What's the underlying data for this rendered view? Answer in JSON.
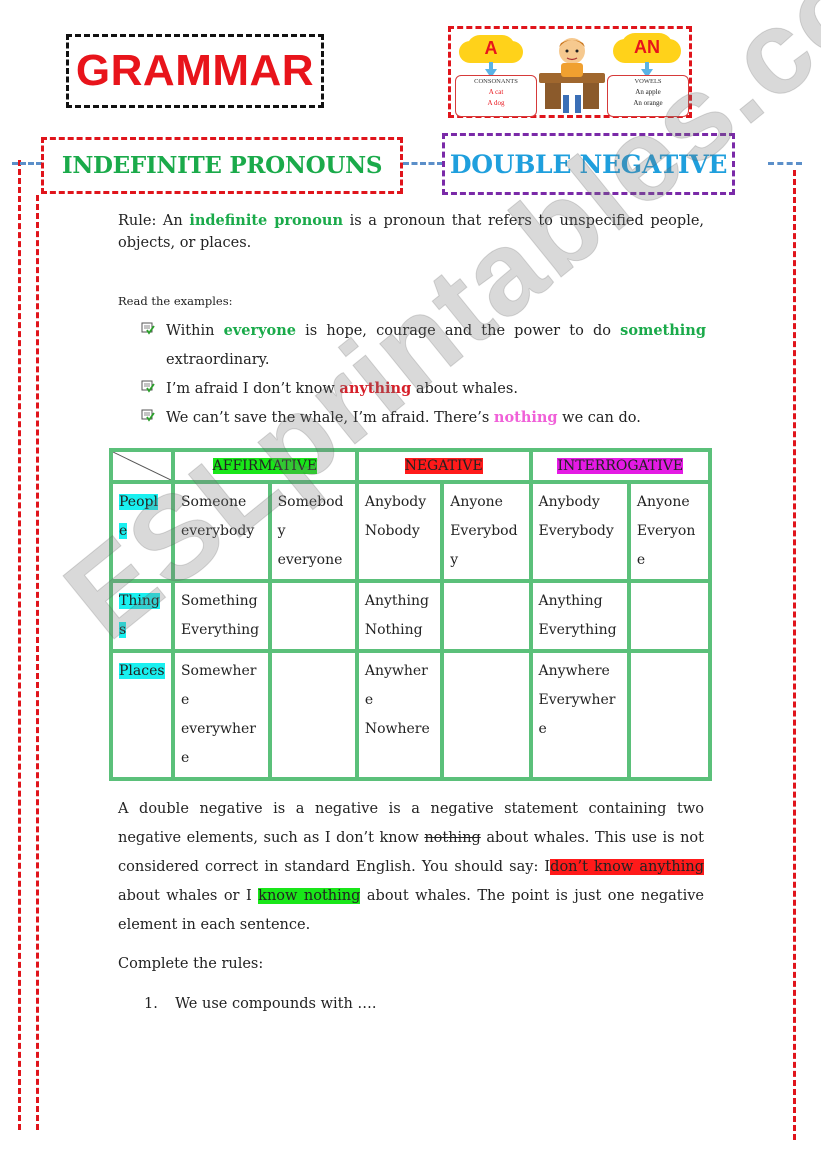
{
  "title": "GRAMMAR",
  "picture": {
    "left_cloud": "A",
    "right_cloud": "AN",
    "left_card": {
      "heading": "CONSONANTS",
      "examples": [
        "A cat",
        "A dog"
      ]
    },
    "right_card": {
      "heading": "VOWELS",
      "examples": [
        "An apple",
        "An orange"
      ]
    }
  },
  "headers": {
    "left": "INDEFINITE PRONOUNS",
    "right": "DOUBLE NEGATIVE"
  },
  "rule": {
    "prefix": "Rule: An",
    "term": "indefinite pronoun",
    "suffix": "is a pronoun that refers to unspecified people, objects, or places."
  },
  "examples_intro": "Read the examples:",
  "examples": [
    {
      "before": "Within",
      "highlight1": "everyone",
      "middle": "is hope, courage and the power to do",
      "highlight2": "something",
      "after": "extraordinary."
    },
    {
      "before": "I’m afraid I don’t know",
      "highlight1": "anything",
      "after": "about whales."
    },
    {
      "before": "We can’t save the whale, I’m afraid. There’s",
      "highlight1": "nothing",
      "after": "we can do."
    }
  ],
  "table": {
    "columns": [
      "AFFIRMATIVE",
      "NEGATIVE",
      "INTERROGATIVE"
    ],
    "colors": {
      "affirmative": "#19e619",
      "negative": "#ff1a1a",
      "interrogative": "#e41ae4",
      "row_label": "#19f0f0",
      "border": "#5bc07a"
    },
    "rows": [
      {
        "label": [
          "Peopl",
          "e"
        ],
        "cells": [
          [
            "Someone",
            "everybody"
          ],
          [
            "Somebod",
            "y",
            "everyone"
          ],
          [
            "Anybody",
            "Nobody"
          ],
          [
            "Anyone",
            "Everybod",
            "y"
          ],
          [
            "Anybody",
            "Everybody"
          ],
          [
            "Anyone",
            "Everyon",
            "e"
          ]
        ]
      },
      {
        "label": [
          "Thing",
          "s"
        ],
        "cells": [
          [
            "Something",
            "Everything"
          ],
          [],
          [
            "Anything",
            "Nothing"
          ],
          [],
          [
            "Anything",
            "Everything"
          ],
          []
        ]
      },
      {
        "label": [
          "Places"
        ],
        "cells": [
          [
            "Somewher",
            "e",
            "everywher",
            "e"
          ],
          [],
          [
            "Anywher",
            "e",
            "Nowhere"
          ],
          [],
          [
            "Anywhere",
            "Everywher",
            "e"
          ],
          []
        ]
      }
    ]
  },
  "double_negative": {
    "p1": "A double negative is a negative is a negative statement containing two negative elements, such as I don’t know",
    "strike": "nothing",
    "p2": "about whales. This use is not considered correct in standard English. You should say: I",
    "red_hl": "don’t know anything",
    "p3": "about whales or I",
    "green_hl": "know nothing",
    "p4": "about whales. The point is just one negative element in each sentence."
  },
  "complete_rules": {
    "label": "Complete the rules:",
    "items": [
      {
        "num": "1.",
        "text": "We use compounds with …."
      }
    ]
  },
  "watermark": "ESLprintables.com"
}
